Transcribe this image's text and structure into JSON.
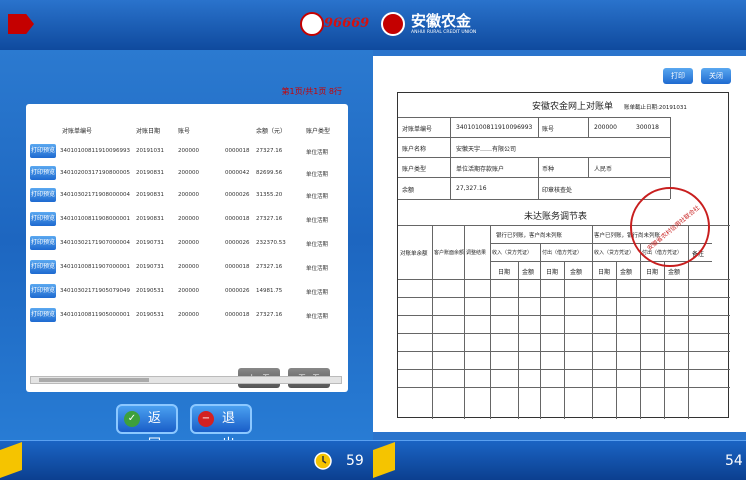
{
  "left_screen": {
    "hotline_text": "96669",
    "page_indicator": "第1页/共1页 8行",
    "columns": [
      "对账单编号",
      "对账日期",
      "账号",
      "余额（元）",
      "账户类型"
    ],
    "print_label": "打印预览",
    "rows": [
      {
        "id": "34010100811910096993",
        "date": "20191031",
        "acct_a": "200000",
        "acct_b": "300000018",
        "bal": "27327.16",
        "type": "单位活期"
      },
      {
        "id": "34010200317190800005",
        "date": "20190831",
        "acct_a": "200000",
        "acct_b": "300000042",
        "bal": "82699.56",
        "type": "单位活期"
      },
      {
        "id": "34010302171908000004",
        "date": "20190831",
        "acct_a": "200000",
        "acct_b": "300000026",
        "bal": "31355.20",
        "type": "单位活期"
      },
      {
        "id": "34010100811908000001",
        "date": "20190831",
        "acct_a": "200000",
        "acct_b": "300000018",
        "bal": "27327.16",
        "type": "单位活期"
      },
      {
        "id": "34010302171907000004",
        "date": "20190731",
        "acct_a": "200000",
        "acct_b": "300000026",
        "bal": "232370.53",
        "type": "单位活期"
      },
      {
        "id": "34010100811907000001",
        "date": "20190731",
        "acct_a": "200000",
        "acct_b": "300000018",
        "bal": "27327.16",
        "type": "单位活期"
      },
      {
        "id": "34010302171905079049",
        "date": "20190531",
        "acct_a": "200000",
        "acct_b": "300000026",
        "bal": "14981.75",
        "type": "单位活期"
      },
      {
        "id": "34010100811905000001",
        "date": "20190531",
        "acct_a": "200000",
        "acct_b": "300000018",
        "bal": "27327.16",
        "type": "单位活期"
      }
    ],
    "prev_label": "上一页",
    "next_label": "下一页",
    "back_label": "返回",
    "exit_label": "退出",
    "timer": "59"
  },
  "right_screen": {
    "brand_cn": "安徽农金",
    "brand_en": "ANHUI RURAL CREDIT UNION",
    "print_label": "打印",
    "close_label": "关闭",
    "statement": {
      "title": "安徽农金网上对账单",
      "deadline": "账单截止日期:20191031",
      "row1_label": "对账单编号",
      "row1_value": "34010100811910096993",
      "row1_label2": "账号",
      "row1_acct_a": "200000",
      "row1_acct_b": "300018",
      "row2_label": "账户名称",
      "row2_value": "安徽天宇……有限公司",
      "row3_label": "账户类型",
      "row3_value": "单位活期存款账户",
      "row3_label2": "币种",
      "row3_value2": "人民币",
      "row4_label": "余额",
      "row4_value": "27,327.16",
      "row4_label2": "印章核查处",
      "recon_title": "未达账务调节表",
      "h_bank_bal": "对账单余额",
      "h_cust_bal": "客户账面余额",
      "h_adjust": "调整结果",
      "h_bank_group": "银行已列账，客户尚未列账",
      "h_cust_group": "客户已列账，银行尚未列账",
      "h_income": "收入（贷方凭证）",
      "h_expense": "付出（借方凭证）",
      "h_remark": "备注",
      "h_date": "日期",
      "h_amount": "金额"
    },
    "stamp_text": "安徽省农村信用社联合社",
    "timer": "54"
  }
}
